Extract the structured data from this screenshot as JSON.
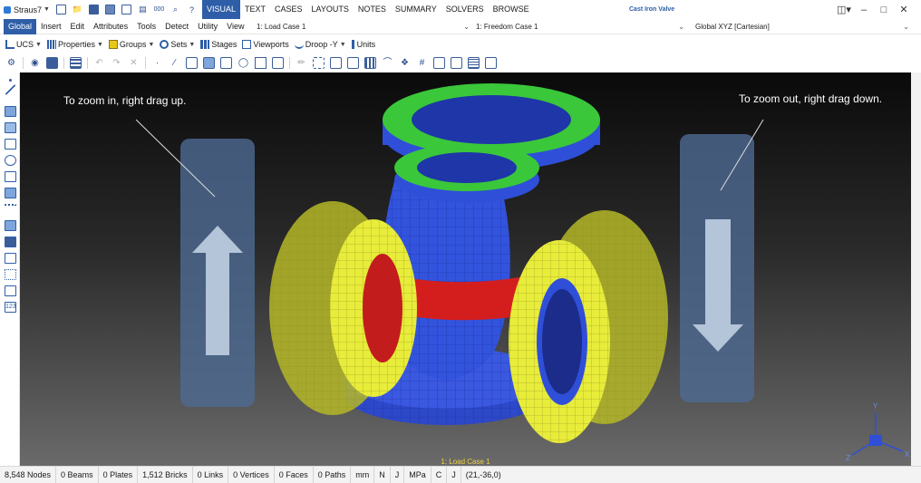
{
  "app": {
    "name": "Straus7",
    "file_title": "Cast Iron Valve"
  },
  "main_tabs": [
    "VISUAL",
    "TEXT",
    "CASES",
    "LAYOUTS",
    "NOTES",
    "SUMMARY",
    "SOLVERS",
    "BROWSE"
  ],
  "menu": [
    "Global",
    "Insert",
    "Edit",
    "Attributes",
    "Tools",
    "Detect",
    "Utility",
    "View"
  ],
  "dropdowns": {
    "load_case": "1: Load Case 1",
    "freedom_case": "1: Freedom Case 1",
    "coordinate_system": "Global XYZ [Cartesian]"
  },
  "toolbar1": [
    {
      "label": "UCS",
      "icon": "ucs-icon"
    },
    {
      "label": "Properties",
      "icon": "properties-icon"
    },
    {
      "label": "Groups",
      "icon": "groups-icon"
    },
    {
      "label": "Sets",
      "icon": "sets-icon"
    },
    {
      "label": "Stages",
      "icon": "stages-icon"
    },
    {
      "label": "Viewports",
      "icon": "viewports-icon"
    },
    {
      "label": "Droop -Y",
      "icon": "droop-icon"
    },
    {
      "label": "Units",
      "icon": "units-icon"
    }
  ],
  "hints": {
    "zoom_in": "To zoom in, right drag up.",
    "zoom_out": "To zoom out, right drag down."
  },
  "viewport": {
    "case_label": "1: Load Case 1"
  },
  "axes": {
    "x": "X",
    "y": "Y",
    "z": "Z"
  },
  "status": {
    "nodes": "8,548 Nodes",
    "beams": "0 Beams",
    "plates": "0 Plates",
    "bricks": "1,512 Bricks",
    "links": "0 Links",
    "vertices": "0 Vertices",
    "faces": "0 Faces",
    "paths": "0 Paths",
    "unit_length": "mm",
    "unit_force": "N",
    "unit_energy": "J",
    "unit_stress": "MPa",
    "unit_temp": "C",
    "unit_energy2": "J",
    "cursor": "(21,-36,0)"
  },
  "colors": {
    "accent": "#2f5ea8",
    "mesh_blue": "#2f4fd8",
    "mesh_green": "#2ec52e",
    "mesh_yellow": "#e8ec3a",
    "mesh_red": "#d41e1e"
  }
}
